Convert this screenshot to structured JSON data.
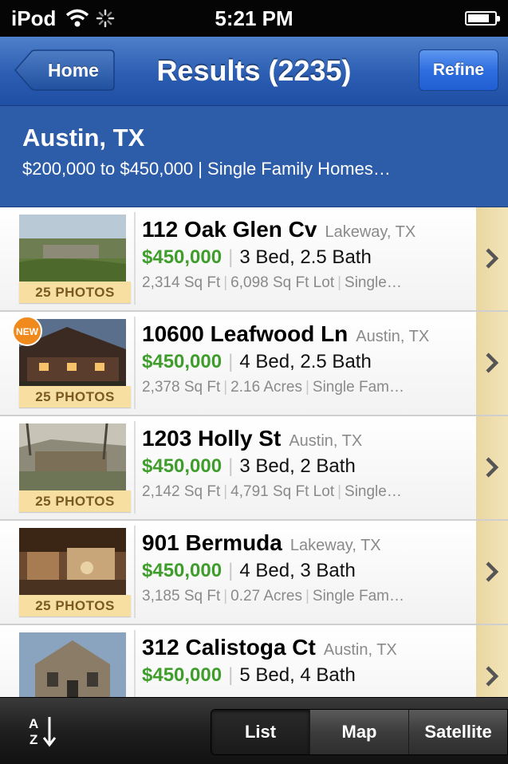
{
  "status_bar": {
    "carrier": "iPod",
    "time": "5:21 PM"
  },
  "nav": {
    "back_label": "Home",
    "title": "Results (2235)",
    "refine_label": "Refine"
  },
  "search": {
    "location": "Austin, TX",
    "criteria": "$200,000 to $450,000 | Single Family Homes…"
  },
  "listings": [
    {
      "address": "112 Oak Glen Cv",
      "city": "Lakeway, TX",
      "price": "$450,000",
      "beds_baths": "3 Bed, 2.5 Bath",
      "sqft": "2,314 Sq Ft",
      "lot": "6,098 Sq Ft Lot",
      "type": "Single…",
      "photos": "25 PHOTOS",
      "new": false
    },
    {
      "address": "10600 Leafwood Ln",
      "city": "Austin, TX",
      "price": "$450,000",
      "beds_baths": "4 Bed, 2.5 Bath",
      "sqft": "2,378 Sq Ft",
      "lot": "2.16 Acres",
      "type": "Single Fam…",
      "photos": "25 PHOTOS",
      "new": true,
      "new_label": "NEW"
    },
    {
      "address": "1203 Holly St",
      "city": "Austin, TX",
      "price": "$450,000",
      "beds_baths": "3 Bed, 2 Bath",
      "sqft": "2,142 Sq Ft",
      "lot": "4,791 Sq Ft Lot",
      "type": "Single…",
      "photos": "25 PHOTOS",
      "new": false
    },
    {
      "address": "901 Bermuda",
      "city": "Lakeway, TX",
      "price": "$450,000",
      "beds_baths": "4 Bed, 3 Bath",
      "sqft": "3,185 Sq Ft",
      "lot": "0.27 Acres",
      "type": "Single Fam…",
      "photos": "25 PHOTOS",
      "new": false
    },
    {
      "address": "312 Calistoga Ct",
      "city": "Austin, TX",
      "price": "$450,000",
      "beds_baths": "5 Bed, 4 Bath",
      "sqft": "",
      "lot": "",
      "type": "",
      "photos": "",
      "new": false
    }
  ],
  "toolbar": {
    "sort_icon": "sort-az-icon",
    "tabs": [
      "List",
      "Map",
      "Satellite"
    ],
    "selected_tab": "List"
  },
  "colors": {
    "nav_blue": "#2b5db2",
    "price_green": "#3f9d2b",
    "photo_tag": "#f6dfa0"
  }
}
